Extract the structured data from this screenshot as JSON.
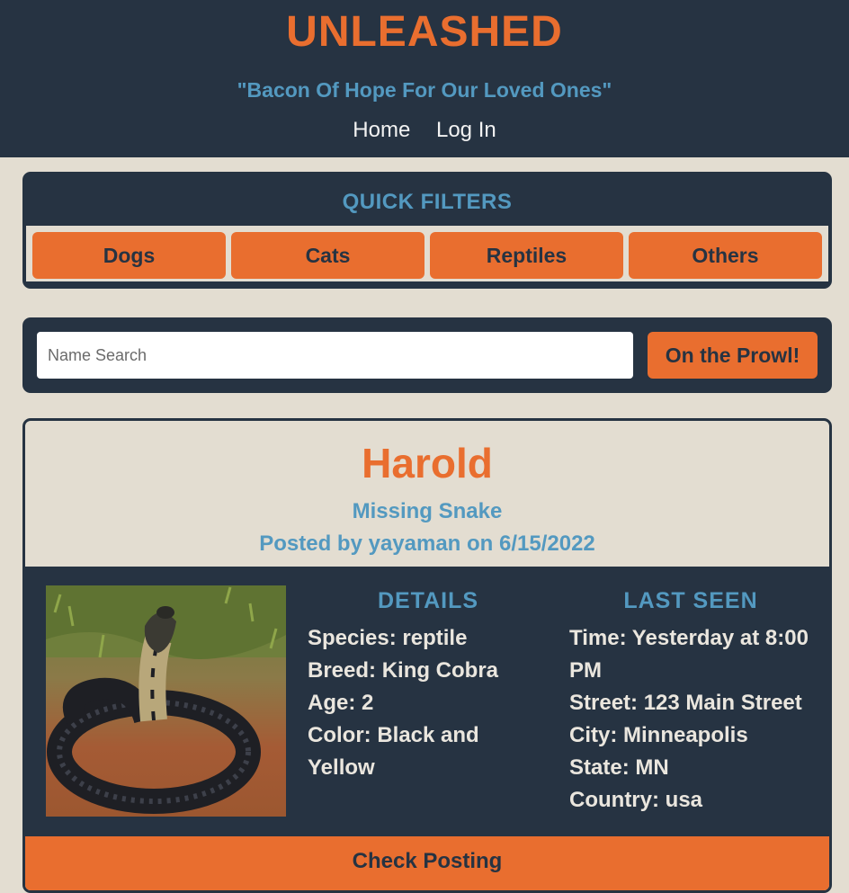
{
  "header": {
    "brand": "UNLEASHED",
    "tagline": "\"Bacon Of Hope For Our Loved Ones\"",
    "nav": [
      "Home",
      "Log In"
    ]
  },
  "filters": {
    "title": "QUICK FILTERS",
    "buttons": [
      "Dogs",
      "Cats",
      "Reptiles",
      "Others"
    ]
  },
  "search": {
    "placeholder": "Name Search",
    "value": "",
    "button_label": "On the Prowl!"
  },
  "post": {
    "name": "Harold",
    "status": "Missing Snake",
    "posted": "Posted by yayaman on 6/15/2022",
    "details_title": "DETAILS",
    "details": [
      "Species: reptile",
      "Breed: King Cobra",
      "Age: 2",
      "Color: Black and Yellow"
    ],
    "last_seen_title": "LAST SEEN",
    "last_seen": [
      "Time: Yesterday at 8:00 PM",
      "Street: 123 Main Street",
      "City: Minneapolis",
      "State: MN",
      "Country: usa"
    ],
    "action_label": "Check Posting"
  },
  "colors": {
    "navy": "#263342",
    "orange": "#e96e2f",
    "blue": "#5399c0",
    "beige": "#e3ddd1"
  }
}
